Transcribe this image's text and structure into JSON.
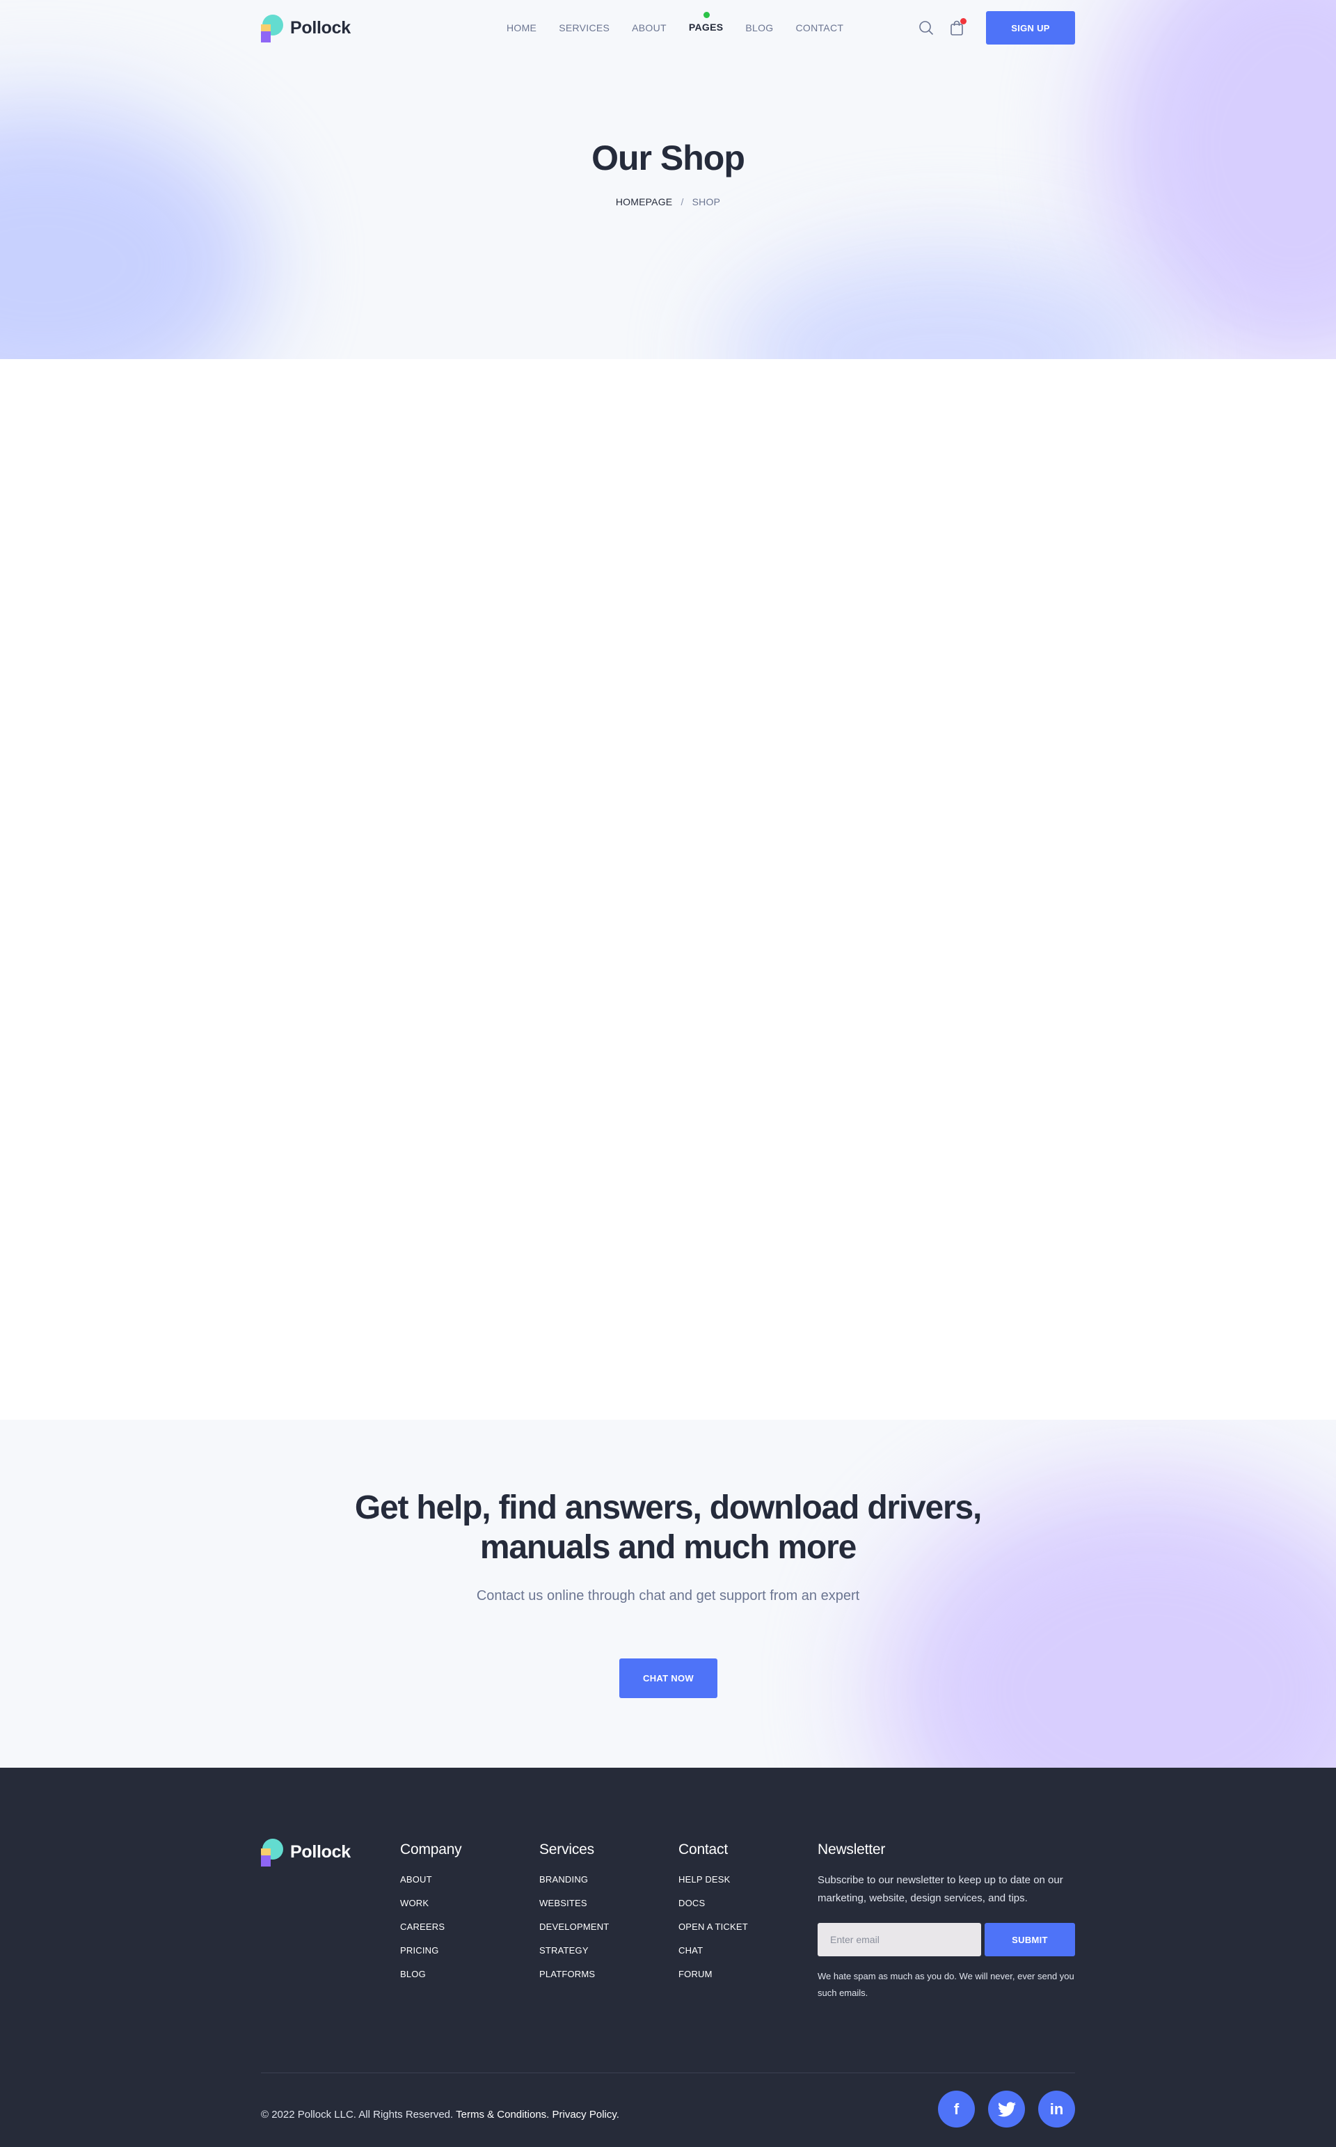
{
  "brand": {
    "name": "Pollock"
  },
  "nav": {
    "items": [
      {
        "label": "HOME"
      },
      {
        "label": "SERVICES"
      },
      {
        "label": "ABOUT"
      },
      {
        "label": "PAGES",
        "active": true
      },
      {
        "label": "BLOG"
      },
      {
        "label": "CONTACT"
      }
    ],
    "search_icon": "search-icon",
    "cart_icon": "shopping-bag-icon",
    "signup_label": "SIGN UP"
  },
  "hero": {
    "title": "Our Shop",
    "breadcrumb": {
      "home": "HOMEPAGE",
      "separator": "/",
      "current": "SHOP"
    }
  },
  "cta": {
    "title_line1": "Get help, find answers, download drivers,",
    "title_line2": "manuals and much more",
    "subtitle": "Contact us online through chat and get support from an expert",
    "button_label": "CHAT NOW"
  },
  "footer": {
    "columns": [
      {
        "title": "Company",
        "links": [
          "ABOUT",
          "WORK",
          "CAREERS",
          "PRICING",
          "BLOG"
        ]
      },
      {
        "title": "Services",
        "links": [
          "BRANDING",
          "WEBSITES",
          "DEVELOPMENT",
          "STRATEGY",
          "PLATFORMS"
        ]
      },
      {
        "title": "Contact",
        "links": [
          "HELP DESK",
          "DOCS",
          "OPEN A TICKET",
          "CHAT",
          "FORUM"
        ]
      }
    ],
    "newsletter": {
      "title": "Newsletter",
      "text": "Subscribe to our newsletter to keep up to date on our marketing, website, design services, and tips.",
      "placeholder": "Enter email",
      "submit_label": "SUBMIT",
      "note": "We hate spam as much as you do. We will never, ever send you such emails."
    },
    "copyright": "© 2022 Pollock LLC. All Rights Reserved.",
    "terms_label": "Terms & Conditions.",
    "privacy_label": "Privacy Policy.",
    "social": [
      {
        "icon": "facebook-icon",
        "glyph": "f"
      },
      {
        "icon": "twitter-icon",
        "glyph": ""
      },
      {
        "icon": "linkedin-icon",
        "glyph": "in"
      }
    ]
  },
  "colors": {
    "primary": "#4e73f8",
    "heading": "#252b3b",
    "muted": "#6b7591",
    "footer_bg": "#262b39",
    "active_dot": "#2bc248",
    "cart_badge": "#f1353b"
  }
}
